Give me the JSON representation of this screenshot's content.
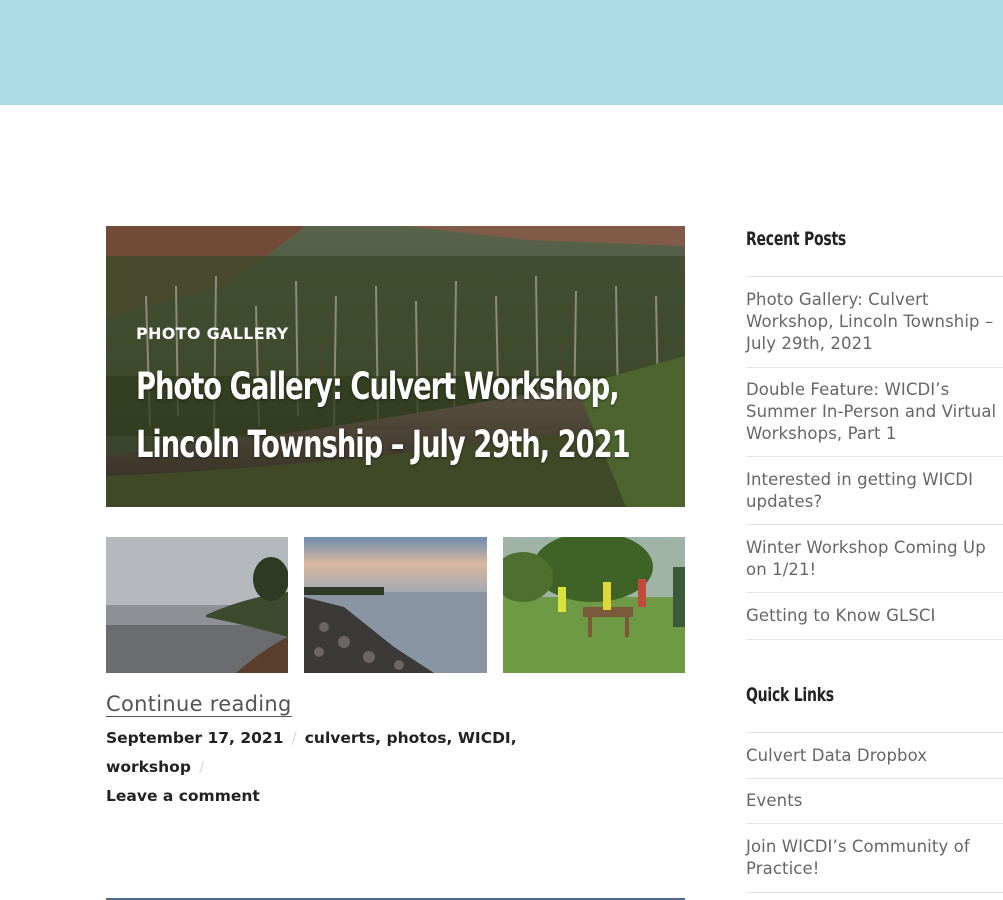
{
  "colors": {
    "top_band": "#acdbe6",
    "text_dark": "#222222",
    "text_muted": "#666666"
  },
  "post": {
    "category": "PHOTO GALLERY",
    "title_line1": "Photo Gallery: Culvert Workshop,",
    "title_line2": "Lincoln Township – July 29th, 2021",
    "continue_reading": "Continue reading",
    "date": "September 17, 2021",
    "tags": [
      "culverts",
      "photos",
      "WICDI",
      "workshop"
    ],
    "comment_link": "Leave a comment"
  },
  "sidebar": {
    "recent_posts": {
      "title": "Recent Posts",
      "items": [
        "Photo Gallery: Culvert Workshop, Lincoln Township – July 29th, 2021",
        "Double Feature: WICDI’s Summer In-Person and Virtual Workshops, Part 1",
        "Interested in getting WICDI updates?",
        "Winter Workshop Coming Up on 1/21!",
        "Getting to Know GLSCI"
      ]
    },
    "quick_links": {
      "title": "Quick Links",
      "items": [
        "Culvert Data Dropbox",
        "Events",
        "Join WICDI’s Community of Practice!"
      ]
    }
  }
}
